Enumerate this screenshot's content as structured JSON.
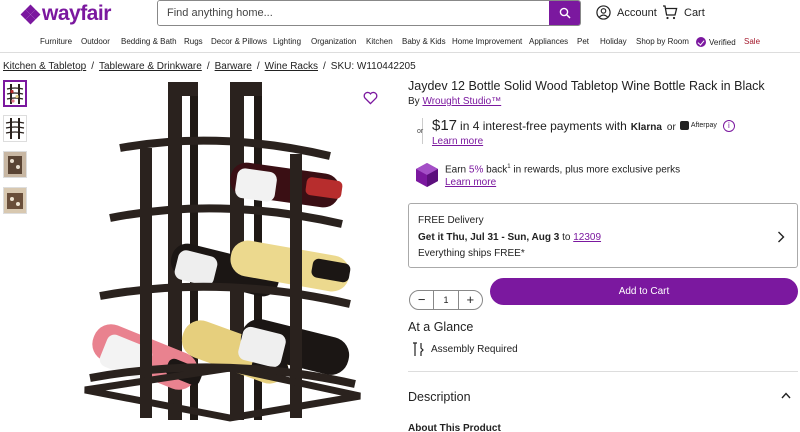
{
  "header": {
    "logo": "wayfair",
    "search_placeholder": "Find anything home...",
    "account_label": "Account",
    "cart_label": "Cart"
  },
  "nav": {
    "items": [
      "Furniture",
      "Outdoor",
      "Bedding & Bath",
      "Rugs",
      "Decor & Pillows",
      "Lighting",
      "Organization",
      "Kitchen",
      "Baby & Kids",
      "Home Improvement",
      "Appliances",
      "Pet",
      "Holiday",
      "Shop by Room",
      "Verified",
      "Sale"
    ]
  },
  "breadcrumb": {
    "items": [
      "Kitchen & Tabletop",
      "Tableware & Drinkware",
      "Barware",
      "Wine Racks"
    ],
    "separator": "/",
    "sku": "SKU: W110442205"
  },
  "product": {
    "title": "Jaydev 12 Bottle Solid Wood Tabletop Wine Bottle Rack in Black",
    "by_label": "By",
    "brand": "Wrought Studio™"
  },
  "payments": {
    "or_label": "or",
    "amount": "$17",
    "text": "in 4 interest-free payments with",
    "klarna": "Klarna",
    "or2": "or",
    "afterpay": "Afterpay",
    "learn_more": "Learn more"
  },
  "rewards": {
    "earn_prefix": "Earn",
    "pct": "5%",
    "text_a": "back",
    "footnote": "1",
    "text_b": "in rewards, plus more exclusive perks",
    "learn_more": "Learn more"
  },
  "delivery": {
    "free_delivery": "FREE Delivery",
    "get_it": "Get it Thu, Jul 31 - Sun, Aug 3",
    "to_label": "to",
    "zip": "12309",
    "ships": "Everything ships FREE*"
  },
  "purchase": {
    "quantity": "1",
    "minus": "−",
    "plus": "+",
    "add_to_cart": "Add to Cart"
  },
  "glance": {
    "heading": "At a Glance",
    "assembly": "Assembly Required"
  },
  "description": {
    "heading": "Description",
    "about": "About This Product"
  },
  "colors": {
    "brand": "#7b189f",
    "sale": "#a4182b",
    "rack": "#2a221e"
  }
}
